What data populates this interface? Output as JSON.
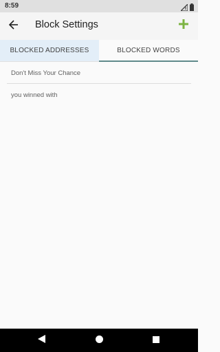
{
  "status_bar": {
    "time": "8:59",
    "icons": [
      "signal-icon",
      "battery-icon"
    ]
  },
  "app_bar": {
    "title": "Block Settings",
    "back_icon": "arrow-left-icon",
    "add_icon": "plus-icon",
    "accent_color": "#7cb342"
  },
  "tabs": [
    {
      "label": "BLOCKED ADDRESSES",
      "active": false
    },
    {
      "label": "BLOCKED WORDS",
      "active": true
    }
  ],
  "blocked_words": [
    "Don't Miss Your Chance",
    "you winned with"
  ],
  "nav_bar": {
    "icons": [
      "back-triangle-icon",
      "home-circle-icon",
      "recents-square-icon"
    ]
  }
}
